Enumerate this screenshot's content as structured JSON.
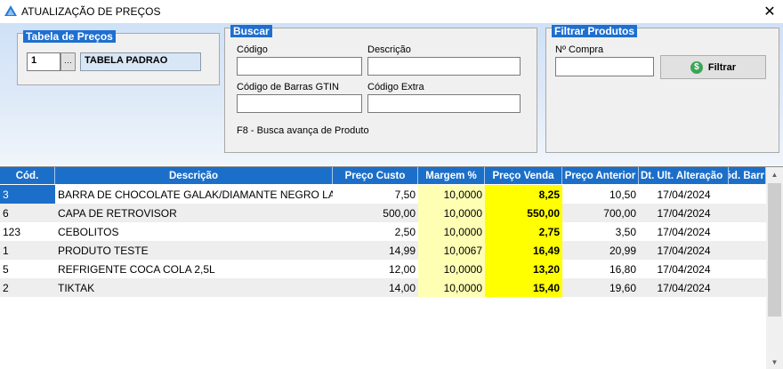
{
  "window": {
    "title": "ATUALIZAÇÃO DE PREÇOS",
    "close_glyph": "✕"
  },
  "tabela_precos": {
    "legend": "Tabela de Preços",
    "code_value": "1",
    "ellipsis": "···",
    "name_value": "TABELA PADRAO"
  },
  "buscar": {
    "legend": "Buscar",
    "codigo_label": "Código",
    "codigo_value": "",
    "descricao_label": "Descrição",
    "descricao_value": "",
    "gtin_label": "Código de Barras GTIN",
    "gtin_value": "",
    "extra_label": "Código Extra",
    "extra_value": "",
    "hint": "F8 - Busca avança de Produto"
  },
  "filtrar": {
    "legend": "Filtrar Produtos",
    "compra_label": "Nº Compra",
    "compra_value": "",
    "button_label": "Filtrar",
    "button_icon_glyph": "$"
  },
  "grid": {
    "columns": [
      "Cód.",
      "Descrição",
      "Preço Custo",
      "Margem %",
      "Preço Venda",
      "Preço Anterior",
      "Dt. Ult. Alteração",
      "Cód. Barr"
    ],
    "rows": [
      {
        "cod": "3",
        "descricao": "BARRA DE CHOCOLATE GALAK/DIAMANTE NEGRO LACTA",
        "custo": "7,50",
        "margem": "10,0000",
        "venda": "8,25",
        "anterior": "10,50",
        "data": "17/04/2024",
        "barras": ""
      },
      {
        "cod": "6",
        "descricao": "CAPA DE RETROVISOR",
        "custo": "500,00",
        "margem": "10,0000",
        "venda": "550,00",
        "anterior": "700,00",
        "data": "17/04/2024",
        "barras": ""
      },
      {
        "cod": "123",
        "descricao": "CEBOLITOS",
        "custo": "2,50",
        "margem": "10,0000",
        "venda": "2,75",
        "anterior": "3,50",
        "data": "17/04/2024",
        "barras": ""
      },
      {
        "cod": "1",
        "descricao": "PRODUTO TESTE",
        "custo": "14,99",
        "margem": "10,0067",
        "venda": "16,49",
        "anterior": "20,99",
        "data": "17/04/2024",
        "barras": ""
      },
      {
        "cod": "5",
        "descricao": "REFRIGENTE COCA COLA 2,5L",
        "custo": "12,00",
        "margem": "10,0000",
        "venda": "13,20",
        "anterior": "16,80",
        "data": "17/04/2024",
        "barras": ""
      },
      {
        "cod": "2",
        "descricao": "TIKTAK",
        "custo": "14,00",
        "margem": "10,0000",
        "venda": "15,40",
        "anterior": "19,60",
        "data": "17/04/2024",
        "barras": ""
      }
    ],
    "scroll_up_glyph": "▲",
    "scroll_down_glyph": "▼"
  },
  "colors": {
    "accent": "#1c6fc9",
    "margin_cell": "#ffffb3",
    "venda_cell": "#ffff00"
  }
}
